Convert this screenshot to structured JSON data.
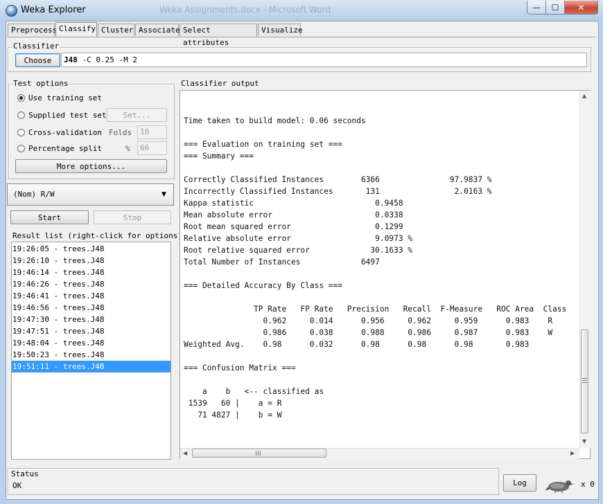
{
  "window": {
    "title": "Weka Explorer",
    "background_title": "Weka Assignments.docx - Microsoft Word",
    "minimize_glyph": "—",
    "maximize_glyph": "☐",
    "close_glyph": "✕"
  },
  "tabs": [
    "Preprocess",
    "Classify",
    "Cluster",
    "Associate",
    "Select attributes",
    "Visualize"
  ],
  "active_tab": "Classify",
  "classifier": {
    "section_label": "Classifier",
    "choose_label": "Choose",
    "name": "J48",
    "options": " -C 0.25 -M 2"
  },
  "test_options": {
    "section_label": "Test options",
    "use_training_set": "Use training set",
    "supplied_test_set": "Supplied test set",
    "set_button": "Set...",
    "cross_validation": "Cross-validation",
    "folds_label": "Folds",
    "folds_value": "10",
    "percentage_split": "Percentage split",
    "percent_label": "%",
    "percent_value": "66",
    "more_options": "More options...",
    "selected": "Use training set"
  },
  "class_selector": {
    "value": "(Nom) R/W",
    "arrow": "▼"
  },
  "actions": {
    "start": "Start",
    "stop": "Stop"
  },
  "result_list": {
    "label": "Result list (right-click for options)",
    "items": [
      "19:26:05 - trees.J48",
      "19:26:10 - trees.J48",
      "19:46:14 - trees.J48",
      "19:46:26 - trees.J48",
      "19:46:41 - trees.J48",
      "19:46:56 - trees.J48",
      "19:47:30 - trees.J48",
      "19:47:51 - trees.J48",
      "19:48:04 - trees.J48",
      "19:50:23 - trees.J48",
      "19:51:11 - trees.J48"
    ],
    "selected_index": 10
  },
  "output": {
    "label": "Classifier output",
    "text": "Time taken to build model: 0.06 seconds\n\n=== Evaluation on training set ===\n=== Summary ===\n\nCorrectly Classified Instances        6366               97.9837 %\nIncorrectly Classified Instances       131                2.0163 %\nKappa statistic                          0.9458\nMean absolute error                      0.0338\nRoot mean squared error                  0.1299\nRelative absolute error                  9.0973 %\nRoot relative squared error             30.1633 %\nTotal Number of Instances             6497\n\n=== Detailed Accuracy By Class ===\n\n               TP Rate   FP Rate   Precision   Recall  F-Measure   ROC Area  Class\n                 0.962     0.014      0.956     0.962     0.959      0.983    R\n                 0.986     0.038      0.988     0.986     0.987      0.983    W\nWeighted Avg.    0.98      0.032      0.98      0.98      0.98       0.983\n\n=== Confusion Matrix ===\n\n    a    b   <-- classified as\n 1539   60 |    a = R\n   71 4827 |    b = W"
  },
  "status": {
    "section_label": "Status",
    "text": "OK",
    "log_button": "Log",
    "task_count": "x 0"
  },
  "icons": {
    "app": "weka-bird-icon",
    "status_bird": "weka-bird-icon"
  },
  "colors": {
    "selection": "#3399ff",
    "titlebar": "#c6d9ee",
    "close_button": "#c8452f"
  }
}
